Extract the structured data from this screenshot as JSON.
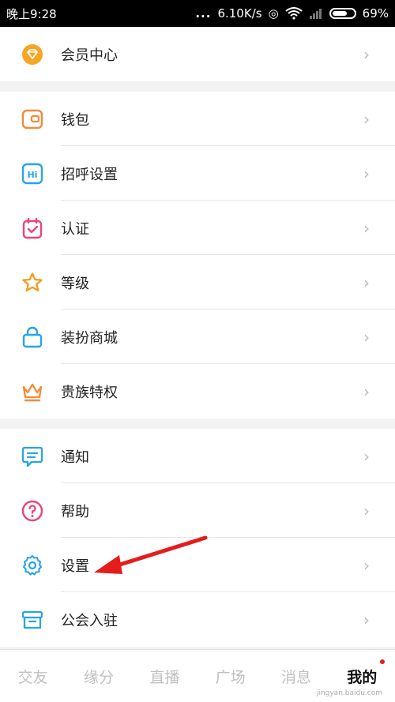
{
  "status_bar": {
    "time": "晚上9:28",
    "dots": "...",
    "speed": "6.10K/s",
    "battery": "69%"
  },
  "sections": [
    {
      "items": [
        {
          "label": "会员中心",
          "icon": "vip-gem-icon"
        }
      ]
    },
    {
      "items": [
        {
          "label": "钱包",
          "icon": "wallet-icon"
        },
        {
          "label": "招呼设置",
          "icon": "hi-greeting-icon"
        },
        {
          "label": "认证",
          "icon": "calendar-check-icon"
        },
        {
          "label": "等级",
          "icon": "star-icon"
        },
        {
          "label": "装扮商城",
          "icon": "shopping-bag-icon"
        },
        {
          "label": "贵族特权",
          "icon": "crown-icon"
        }
      ]
    },
    {
      "items": [
        {
          "label": "通知",
          "icon": "notification-chat-icon"
        },
        {
          "label": "帮助",
          "icon": "help-question-icon"
        },
        {
          "label": "设置",
          "icon": "gear-icon"
        },
        {
          "label": "公会入驻",
          "icon": "guild-box-icon"
        }
      ]
    }
  ],
  "tabs": [
    {
      "label": "交友"
    },
    {
      "label": "缘分"
    },
    {
      "label": "直播"
    },
    {
      "label": "广场"
    },
    {
      "label": "消息"
    },
    {
      "label": "我的",
      "active": true
    }
  ],
  "watermark": "jingyan.baidu.com",
  "colors": {
    "orange": "#f5a623",
    "blue": "#29a3e6",
    "pink": "#e8457c",
    "star": "#f59a23",
    "crown": "#f28b3a",
    "arrow": "#e51c1c"
  }
}
